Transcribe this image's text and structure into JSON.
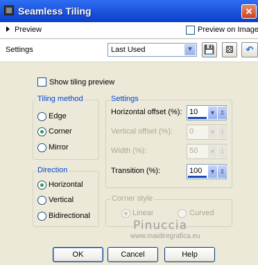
{
  "window": {
    "title": "Seamless Tiling"
  },
  "preview": {
    "label": "Preview",
    "preview_on_image": "Preview on Image"
  },
  "settings_row": {
    "label": "Settings",
    "preset_value": "Last Used"
  },
  "show_tiling_preview": "Show tiling preview",
  "tiling_method": {
    "legend": "Tiling method",
    "options": [
      "Edge",
      "Corner",
      "Mirror"
    ],
    "selected": "Corner"
  },
  "direction": {
    "legend": "Direction",
    "options": [
      "Horizontal",
      "Vertical",
      "Bidirectional"
    ],
    "selected": "Horizontal"
  },
  "settings": {
    "legend": "Settings",
    "horizontal_offset": {
      "label": "Horizontal offset (%):",
      "value": "10"
    },
    "vertical_offset": {
      "label": "Vertical offset (%):",
      "value": "0"
    },
    "width": {
      "label": "Width (%):",
      "value": "50"
    },
    "transition": {
      "label": "Transition (%):",
      "value": "100"
    }
  },
  "corner_style": {
    "legend": "Corner style",
    "options": [
      "Linear",
      "Curved"
    ],
    "selected": "Linear"
  },
  "buttons": {
    "ok": "OK",
    "cancel": "Cancel",
    "help": "Help"
  },
  "watermark": {
    "name": "Pinuccia",
    "url": "www.maidiregrafica.eu"
  },
  "colors": {
    "title_bar": "#0a3fcb",
    "group_legend": "#0046d5",
    "dialog_bg": "#ece9d8"
  }
}
